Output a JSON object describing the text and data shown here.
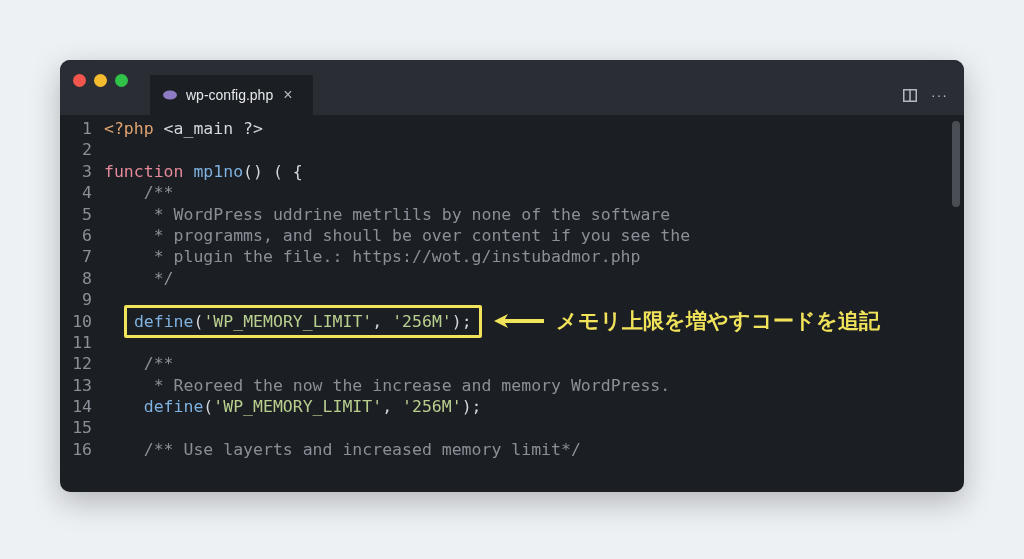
{
  "window": {
    "tab": {
      "title": "wp-config.php",
      "close": "×",
      "selected": true
    },
    "more": "···"
  },
  "lines": [
    {
      "number": "1",
      "tokens": [
        {
          "kind": "tag",
          "text": "<?php"
        },
        {
          "kind": "plain",
          "text": " <a_main ?>"
        }
      ]
    },
    {
      "number": "2"
    },
    {
      "number": "3",
      "tokens": [
        {
          "kind": "keyword",
          "text": "function "
        },
        {
          "kind": "func",
          "text": "mp1no"
        },
        {
          "kind": "plain",
          "text": "() ( {"
        }
      ]
    },
    {
      "number": "4",
      "tokens": [
        {
          "kind": "comment",
          "text": "    /**"
        }
      ]
    },
    {
      "number": "5",
      "tokens": [
        {
          "kind": "comment",
          "text": "     * WordPress uddrine metrlils by none of the software"
        }
      ]
    },
    {
      "number": "6",
      "tokens": [
        {
          "kind": "comment",
          "text": "     * programms, and shoull be over content if you see the"
        }
      ]
    },
    {
      "number": "7",
      "tokens": [
        {
          "kind": "comment",
          "text": "     * plugin the file.: https://wot.g/instubadmor.php"
        }
      ]
    },
    {
      "number": "8",
      "tokens": [
        {
          "kind": "comment",
          "text": "     */"
        }
      ]
    },
    {
      "number": "9"
    },
    {
      "number": "10",
      "highlight": true,
      "annotation": "メモリ上限を増やすコードを追記",
      "tokens": [
        {
          "kind": "func",
          "text": "define"
        },
        {
          "kind": "plain",
          "text": "("
        },
        {
          "kind": "string",
          "text": "'WP_MEMORY_LIMIT'"
        },
        {
          "kind": "plain",
          "text": ", "
        },
        {
          "kind": "string",
          "text": "'256M'"
        },
        {
          "kind": "plain",
          "text": ");"
        }
      ]
    },
    {
      "number": "11"
    },
    {
      "number": "12",
      "tokens": [
        {
          "kind": "comment",
          "text": "    /**"
        }
      ]
    },
    {
      "number": "13",
      "tokens": [
        {
          "kind": "comment",
          "text": "     * Reoreed the now the increase and memory WordPress."
        }
      ]
    },
    {
      "number": "14",
      "tokens": [
        {
          "kind": "func",
          "text": "    define"
        },
        {
          "kind": "plain",
          "text": "("
        },
        {
          "kind": "string",
          "text": "'WP_MEMORY_LIMIT'"
        },
        {
          "kind": "plain",
          "text": ", "
        },
        {
          "kind": "string",
          "text": "'256M'"
        },
        {
          "kind": "plain",
          "text": ");"
        }
      ]
    },
    {
      "number": "15"
    },
    {
      "number": "16",
      "tokens": [
        {
          "kind": "comment",
          "text": "    /** Use layerts and increased memory limit*/"
        }
      ]
    }
  ]
}
